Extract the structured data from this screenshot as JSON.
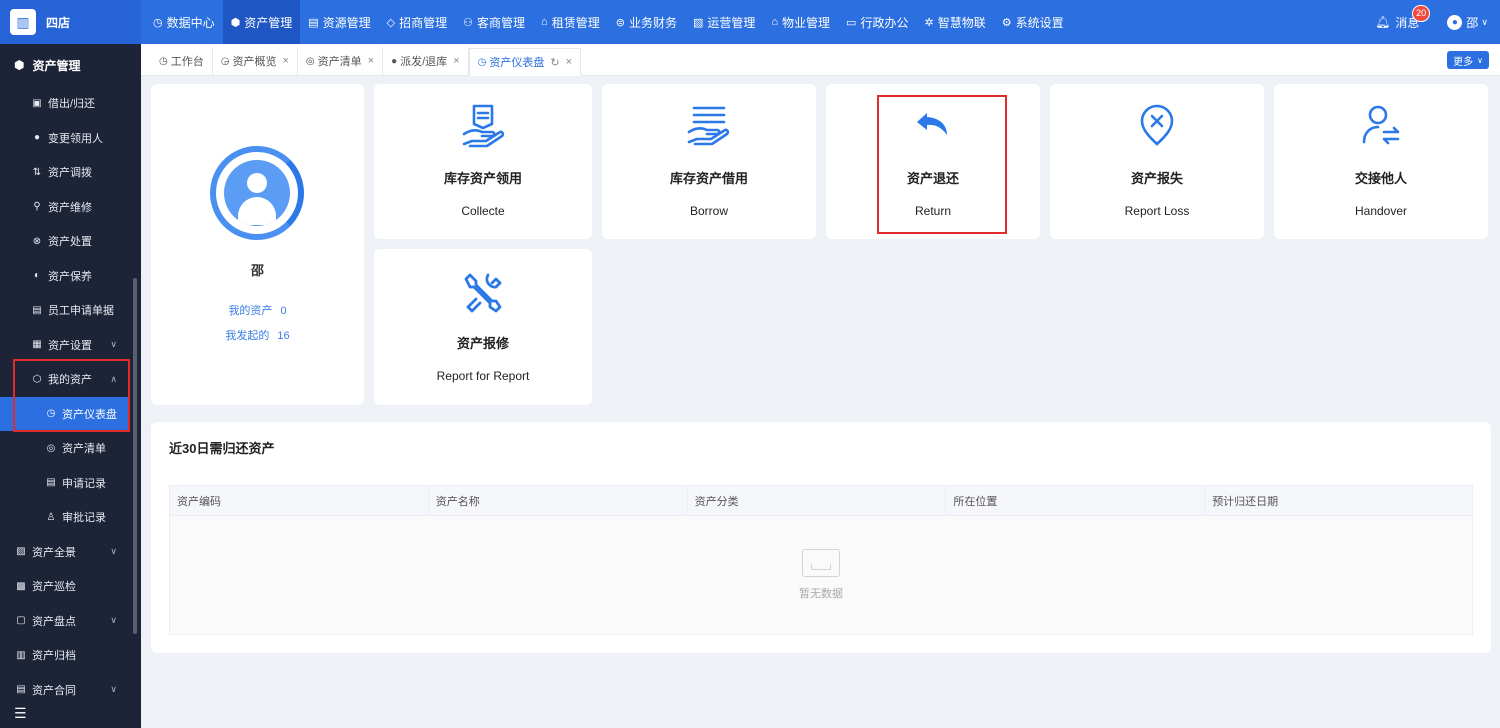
{
  "app": {
    "logo_icon": "building-icon",
    "name": "四店"
  },
  "topnav": [
    {
      "label": "数据中心",
      "icon": "dashboard-icon",
      "glyph": "◷"
    },
    {
      "label": "资产管理",
      "icon": "cube-icon",
      "glyph": "⬢"
    },
    {
      "label": "资源管理",
      "icon": "document-icon",
      "glyph": "▤"
    },
    {
      "label": "招商管理",
      "icon": "diamond-icon",
      "glyph": "◇"
    },
    {
      "label": "客商管理",
      "icon": "users-icon",
      "glyph": "⚇"
    },
    {
      "label": "租赁管理",
      "icon": "house-icon",
      "glyph": "⌂"
    },
    {
      "label": "业务财务",
      "icon": "coin-icon",
      "glyph": "⊜"
    },
    {
      "label": "运营管理",
      "icon": "chart-icon",
      "glyph": "▧"
    },
    {
      "label": "物业管理",
      "icon": "home-icon",
      "glyph": "⌂"
    },
    {
      "label": "行政办公",
      "icon": "monitor-icon",
      "glyph": "▭"
    },
    {
      "label": "智慧物联",
      "icon": "iot-icon",
      "glyph": "✲"
    },
    {
      "label": "系统设置",
      "icon": "gear-icon",
      "glyph": "⚙"
    }
  ],
  "header": {
    "messages_label": "消息",
    "messages_count": "20",
    "user_name": "邵"
  },
  "sidebar": {
    "title": "资产管理",
    "items": [
      {
        "label": "借出/归还",
        "glyph": "▣",
        "icon": "borrow-icon",
        "level": "l2"
      },
      {
        "label": "变更领用人",
        "glyph": "●",
        "icon": "user-icon",
        "level": "l2"
      },
      {
        "label": "资产调拨",
        "glyph": "⇅",
        "icon": "transfer-icon",
        "level": "l2"
      },
      {
        "label": "资产维修",
        "glyph": "⚲",
        "icon": "search-icon",
        "level": "l2"
      },
      {
        "label": "资产处置",
        "glyph": "⊗",
        "icon": "dispose-icon",
        "level": "l2"
      },
      {
        "label": "资产保养",
        "glyph": "◐",
        "icon": "maintain-icon",
        "level": "l2"
      },
      {
        "label": "员工申请单据",
        "glyph": "▤",
        "icon": "form-icon",
        "level": "l2"
      },
      {
        "label": "资产设置",
        "glyph": "▦",
        "icon": "settings-icon",
        "level": "l2",
        "chev": "∨"
      },
      {
        "label": "我的资产",
        "glyph": "⬡",
        "icon": "my-assets-icon",
        "level": "l2",
        "chev": "∧"
      },
      {
        "label": "资产仪表盘",
        "glyph": "◷",
        "icon": "dashboard-icon",
        "level": "sub",
        "active": true
      },
      {
        "label": "资产清单",
        "glyph": "◎",
        "icon": "list-icon",
        "level": "sub"
      },
      {
        "label": "申请记录",
        "glyph": "▤",
        "icon": "record-icon",
        "level": "sub"
      },
      {
        "label": "审批记录",
        "glyph": "♙",
        "icon": "approve-icon",
        "level": "sub"
      },
      {
        "label": "资产全景",
        "glyph": "▨",
        "icon": "panorama-icon",
        "level": "top2",
        "chev": "∨"
      },
      {
        "label": "资产巡检",
        "glyph": "▩",
        "icon": "inspect-icon",
        "level": "top2"
      },
      {
        "label": "资产盘点",
        "glyph": "▢",
        "icon": "inventory-icon",
        "level": "top2",
        "chev": "∨"
      },
      {
        "label": "资产归档",
        "glyph": "▥",
        "icon": "archive-icon",
        "level": "top2"
      },
      {
        "label": "资产合同",
        "glyph": "▤",
        "icon": "contract-icon",
        "level": "top2",
        "chev": "∨"
      }
    ],
    "collapse_icon": "collapse-menu-icon"
  },
  "tabs": [
    {
      "label": "工作台",
      "glyph": "◷",
      "closable": false
    },
    {
      "label": "资产概览",
      "glyph": "◶",
      "closable": true
    },
    {
      "label": "资产清单",
      "glyph": "◎",
      "closable": true
    },
    {
      "label": "派发/退库",
      "glyph": "●",
      "closable": true
    },
    {
      "label": "资产仪表盘",
      "glyph": "◷",
      "closable": true,
      "active": true
    }
  ],
  "more_label": "更多",
  "profile": {
    "name": "邵",
    "my_assets_label": "我的资产",
    "my_assets_count": "0",
    "initiated_label": "我发起的",
    "initiated_count": "16"
  },
  "actions": [
    {
      "cn": "库存资产领用",
      "en": "Collecte",
      "icon": "collect-icon"
    },
    {
      "cn": "库存资产借用",
      "en": "Borrow",
      "icon": "borrow-hand-icon"
    },
    {
      "cn": "资产退还",
      "en": "Return",
      "icon": "return-arrow-icon"
    },
    {
      "cn": "资产报失",
      "en": "Report Loss",
      "icon": "location-x-icon"
    },
    {
      "cn": "交接他人",
      "en": "Handover",
      "icon": "user-swap-icon"
    },
    {
      "cn": "资产报修",
      "en": "Report for Report",
      "icon": "tools-icon"
    }
  ],
  "panel": {
    "title": "近30日需归还资产",
    "columns": [
      "资产编码",
      "资产名称",
      "资产分类",
      "所在位置",
      "预计归还日期"
    ],
    "empty_text": "暂无数据"
  },
  "colors": {
    "primary": "#2b6fe0",
    "sidebar": "#1d2438",
    "highlight": "#e02b2b"
  }
}
